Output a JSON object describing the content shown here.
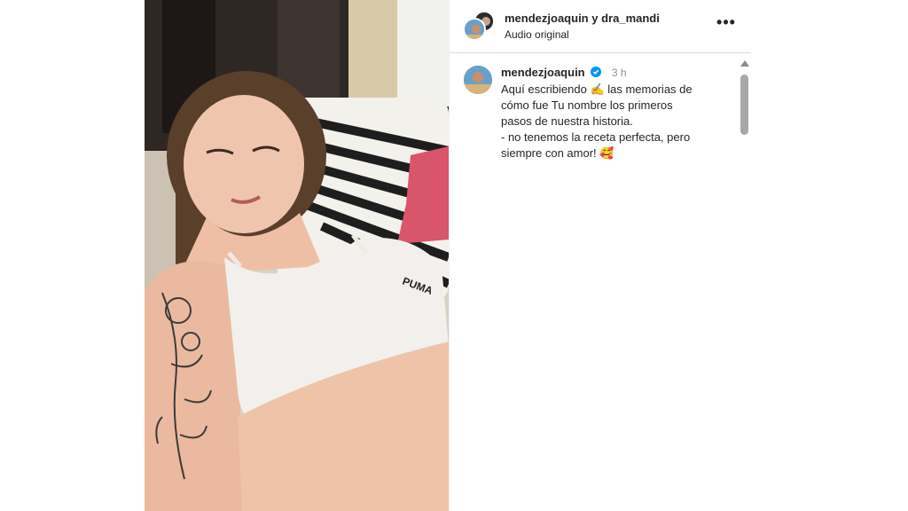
{
  "header": {
    "user1": "mendezjoaquin",
    "connector": "y",
    "user2": "dra_mandi",
    "audio": "Audio original",
    "more_icon": "more-horizontal-icon",
    "more_glyph": "•••"
  },
  "comment": {
    "username": "mendezjoaquin",
    "verified_icon": "verified-badge-icon",
    "time": "3 h",
    "lines": [
      "Aquí escribiendo ✍️ las memorias de",
      "cómo fue Tu nombre los primeros",
      "pasos de nuestra historia.",
      "- no tenemos la receta perfecta, pero",
      "siempre con amor! 🥰"
    ]
  },
  "colors": {
    "verified": "#0095f6",
    "time": "#8e8e8e",
    "divider": "#dbdbdb"
  }
}
